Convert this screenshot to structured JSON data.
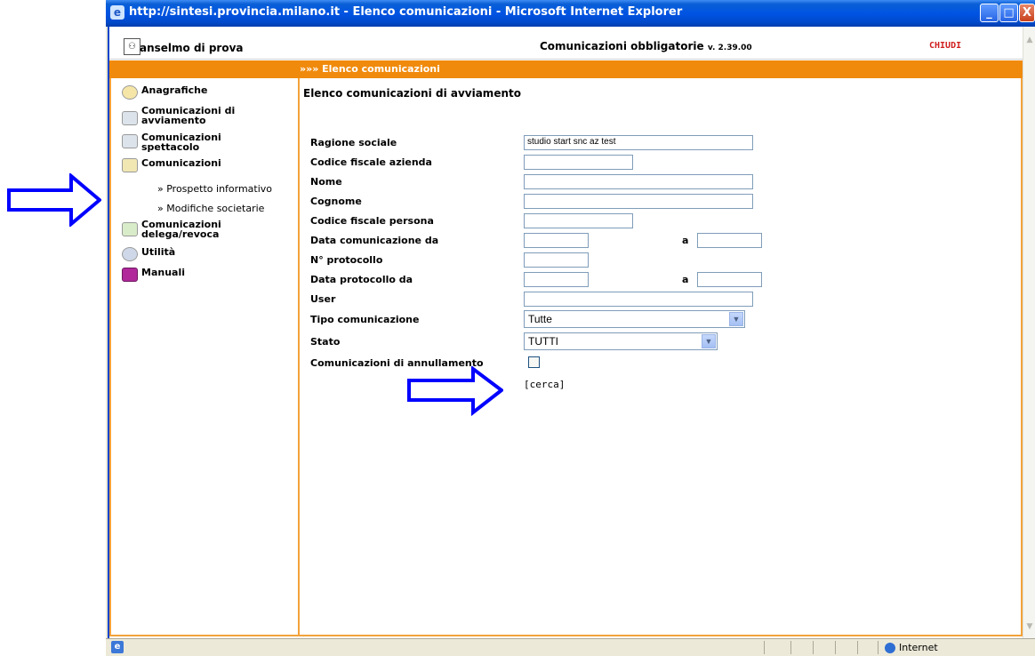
{
  "window": {
    "title": "http://sintesi.provincia.milano.it - Elenco comunicazioni - Microsoft Internet Explorer",
    "buttons": {
      "minimize": "_",
      "maximize": "□",
      "close": "X"
    }
  },
  "header": {
    "user": "anselmo di prova",
    "app_title": "Comunicazioni obbligatorie",
    "version": "v. 2.39.00",
    "close_label": "CHIUDI"
  },
  "breadcrumb": "»»» Elenco comunicazioni",
  "sidebar": {
    "items": [
      {
        "label": "Anagrafiche",
        "icon": "folder-icon"
      },
      {
        "label": "Comunicazioni di avviamento",
        "icon": "document-icon"
      },
      {
        "label": "Comunicazioni spettacolo",
        "icon": "document-icon"
      },
      {
        "label": "Comunicazioni",
        "icon": "document-icon"
      },
      {
        "label": "Comunicazioni delega/revoca",
        "icon": "delegation-icon"
      },
      {
        "label": "Utilità",
        "icon": "tools-icon"
      },
      {
        "label": "Manuali",
        "icon": "books-icon"
      }
    ],
    "subitems": [
      {
        "label": "» Prospetto informativo"
      },
      {
        "label": "» Modifiche societarie"
      }
    ]
  },
  "main": {
    "title": "Elenco comunicazioni di avviamento",
    "form": {
      "ragione_sociale_label": "Ragione sociale",
      "ragione_sociale_value": "studio start snc az test",
      "cf_azienda_label": "Codice fiscale azienda",
      "nome_label": "Nome",
      "cognome_label": "Cognome",
      "cf_persona_label": "Codice fiscale persona",
      "data_com_label": "Data comunicazione da",
      "a_label": "a",
      "protocollo_label": "N° protocollo",
      "data_prot_label": "Data protocollo da",
      "user_label": "User",
      "tipo_label": "Tipo comunicazione",
      "tipo_value": "Tutte",
      "stato_label": "Stato",
      "stato_value": "TUTTI",
      "annullamento_label": "Comunicazioni di annullamento",
      "cerca_label": "[cerca]"
    }
  },
  "status": {
    "zone": "Internet"
  },
  "colors": {
    "orange": "#f08a0c",
    "titlebar_blue": "#0054e3",
    "annotation_blue": "#0000ff"
  }
}
